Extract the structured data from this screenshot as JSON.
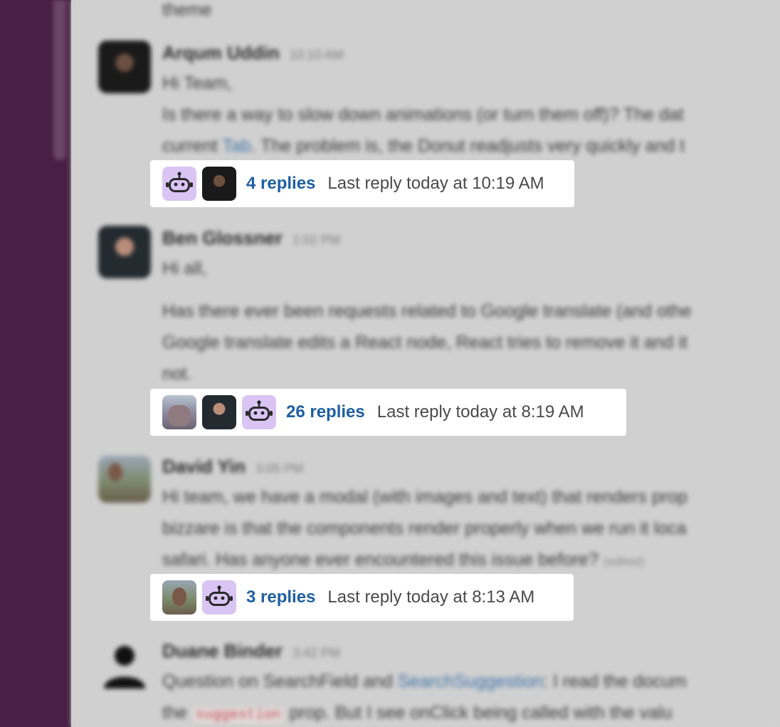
{
  "background_messages": [
    {
      "name": "Arqum Uddin",
      "time": "10:10 AM",
      "lines": [
        "Hi Team,",
        "Is there a way to slow down animations (or turn them off)? The dat",
        "current Tab. The problem is, the Donut readjusts very quickly and t"
      ],
      "link_word": "Tab"
    },
    {
      "name": "Ben Glossner",
      "time": "1:02 PM",
      "lines": [
        "Hi all,",
        "Has there ever been requests related to Google translate (and othe",
        "Google translate edits a React node, React tries to remove it and it",
        "not."
      ]
    },
    {
      "name": "David Yin",
      "time": "3:05 PM",
      "lines": [
        "Hi team, we have a modal (with images and text) that renders prop",
        "bizzare is that the components render properly when we run it loca",
        "safari. Has anyone ever encountered this issue before?"
      ],
      "edited": "(edited)"
    },
    {
      "name": "Duane Binder",
      "time": "3:42 PM",
      "lines": [
        "Question on SearchField and",
        "SearchSuggestion",
        ":   I read the docum",
        "the",
        "suggestion",
        "prop.  But I see onClick being called with the valu"
      ]
    }
  ],
  "top_fragment": "theme",
  "threads": [
    {
      "reply_count": "4 replies",
      "last_reply": "Last reply today at 10:19 AM",
      "avatars": [
        "bot-icon",
        "user-avatar"
      ]
    },
    {
      "reply_count": "26 replies",
      "last_reply": "Last reply today at 8:19 AM",
      "avatars": [
        "user-avatar",
        "user-avatar",
        "bot-icon"
      ]
    },
    {
      "reply_count": "3 replies",
      "last_reply": "Last reply today at 8:13 AM",
      "avatars": [
        "user-avatar",
        "bot-icon"
      ]
    }
  ],
  "colors": {
    "sidebar": "#4a1f47",
    "link": "#1e5fa2",
    "bot_avatar_bg": "#d9c4f3"
  }
}
